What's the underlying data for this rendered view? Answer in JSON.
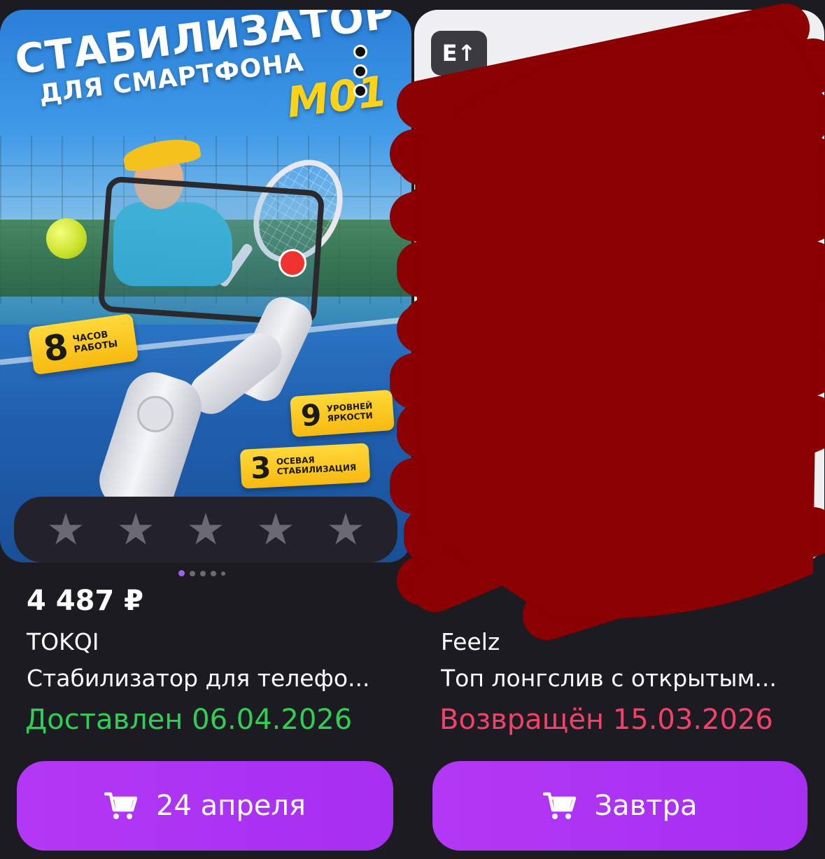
{
  "cards": [
    {
      "image": {
        "headline_line1": "СТАБИЛИЗАТОР",
        "headline_line2": "ДЛЯ СМАРТФОНА",
        "model": "M01",
        "badge_hours_num": "8",
        "badge_hours_text": "ЧАСОВ РАБОТЫ",
        "badge_bright_num": "9",
        "badge_bright_text": "УРОВНЕЙ ЯРКОСТИ",
        "badge_axis_num": "3",
        "badge_axis_text": "ОСЕВАЯ СТАБИЛИЗАЦИЯ"
      },
      "rating": {
        "stars": [
          "★",
          "★",
          "★",
          "★",
          "★"
        ],
        "value": 0
      },
      "carousel": {
        "count": 5,
        "active": 0
      },
      "price": "4 487 ₽",
      "brand": "TOKQI",
      "title": "Стабилизатор для телефо...",
      "status": "Доставлен 06.04.2026",
      "button_label": "24 апреля"
    },
    {
      "image": {
        "tag_text": "E↑"
      },
      "brand": "Feelz",
      "title": "Топ лонгслив с открытым...",
      "status": "Возвращён 15.03.2026",
      "button_label": "Завтра"
    }
  ],
  "colors": {
    "background": "#1c1b21",
    "accent_purple": "#b338f5",
    "status_delivered": "#2fcf55",
    "status_returned": "#f2416b",
    "redaction": "#8b0000"
  }
}
